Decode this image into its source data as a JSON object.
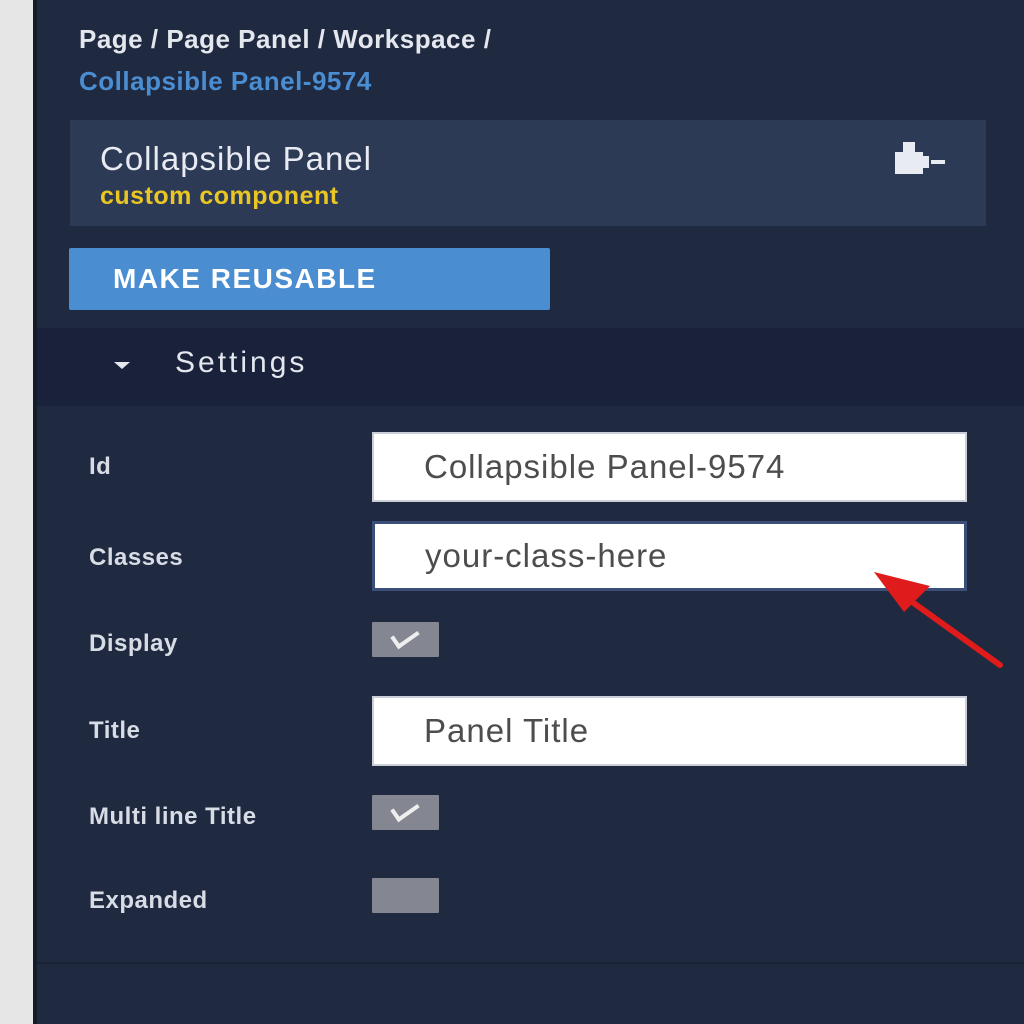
{
  "breadcrumb": {
    "path": "Page / Page Panel / Workspace /",
    "current": "Collapsible Panel-9574"
  },
  "component": {
    "name": "Collapsible Panel",
    "type": "custom component",
    "icon": "puzzle-icon"
  },
  "make_reusable_label": "MAKE REUSABLE",
  "settings": {
    "label": "Settings",
    "fields": {
      "id": {
        "label": "Id",
        "value": "Collapsible Panel-9574"
      },
      "classes": {
        "label": "Classes",
        "value": "your-class-here"
      },
      "display": {
        "label": "Display",
        "checked": true
      },
      "title": {
        "label": "Title",
        "value": "Panel Title"
      },
      "multiline_title": {
        "label": "Multi line Title",
        "checked": true
      },
      "expanded": {
        "label": "Expanded",
        "checked": false
      }
    }
  },
  "colors": {
    "panel_bg": "#1f2940",
    "accent": "#4a8dd1",
    "component_type": "#e9c623",
    "annotation_arrow": "#e01b1b"
  }
}
